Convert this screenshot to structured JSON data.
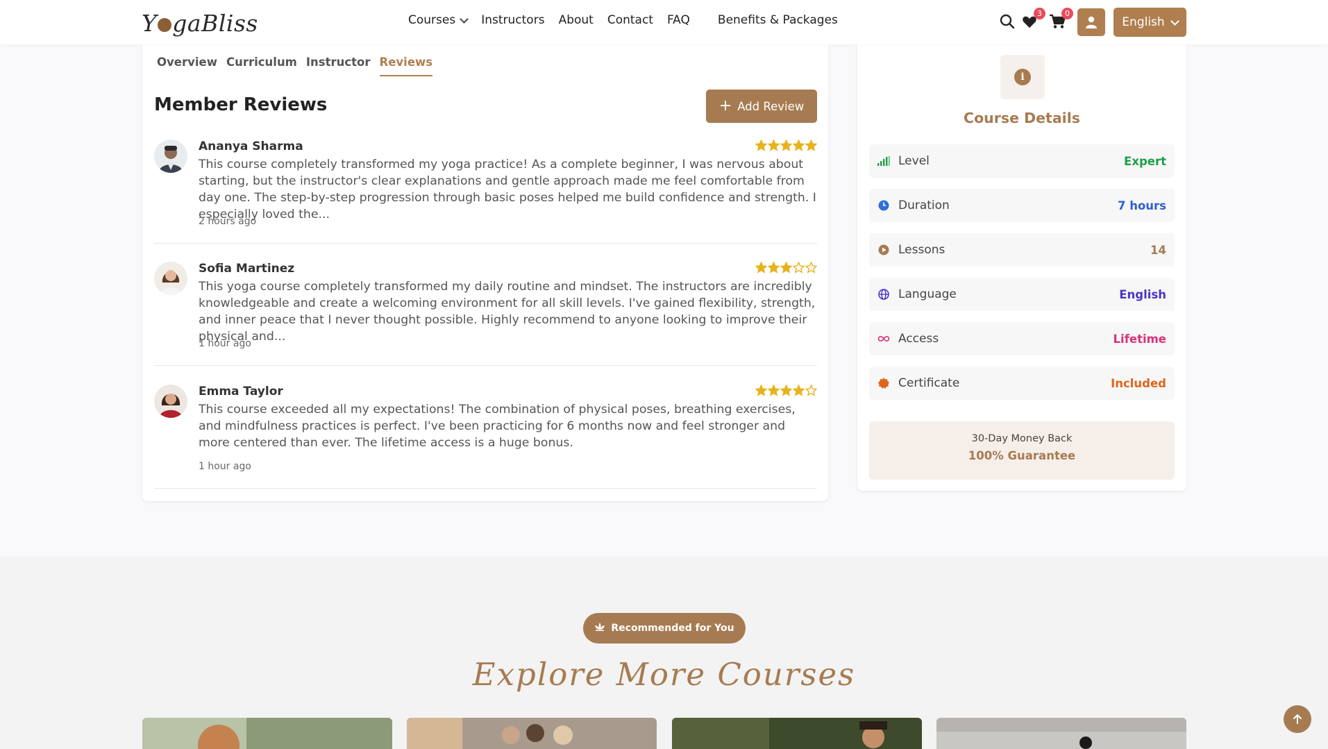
{
  "brand": {
    "name_prefix": "Y",
    "name_suffix": "gaBliss"
  },
  "nav": {
    "courses": "Courses",
    "instructors": "Instructors",
    "about": "About",
    "contact": "Contact",
    "faq": "FAQ",
    "benefits": "Benefits & Packages"
  },
  "header_actions": {
    "wishlist_count": "3",
    "cart_count": "0",
    "language": "English"
  },
  "tabs": [
    "Overview",
    "Curriculum",
    "Instructor",
    "Reviews"
  ],
  "active_tab": "Reviews",
  "reviews_section": {
    "title": "Member Reviews",
    "add_button": "Add Review",
    "reviews": [
      {
        "name": "Ananya Sharma",
        "rating": 5,
        "text": "This course completely transformed my yoga practice! As a complete beginner, I was nervous about starting, but the instructor's clear explanations and gentle approach made me feel comfortable from day one. The step-by-step progression through basic poses helped me build confidence and strength. I especially loved the...",
        "time": "2 hours ago"
      },
      {
        "name": "Sofia Martinez",
        "rating": 3,
        "text": "This yoga course completely transformed my daily routine and mindset. The instructors are incredibly knowledgeable and create a welcoming environment for all skill levels. I've gained flexibility, strength, and inner peace that I never thought possible. Highly recommend to anyone looking to improve their physical and...",
        "time": "1 hour ago"
      },
      {
        "name": "Emma Taylor",
        "rating": 4,
        "text": "This course exceeded all my expectations! The combination of physical poses, breathing exercises, and mindfulness practices is perfect. I've been practicing for 6 months now and feel stronger and more centered than ever. The lifetime access is a huge bonus.",
        "time": "1 hour ago"
      }
    ]
  },
  "course_details": {
    "title": "Course Details",
    "rows": [
      {
        "label": "Level",
        "value": "Expert",
        "color": "#1e9e4a",
        "icon": "signal-bars-icon"
      },
      {
        "label": "Duration",
        "value": "7 hours",
        "color": "#2f5fd0",
        "icon": "clock-icon"
      },
      {
        "label": "Lessons",
        "value": "14",
        "color": "#a77b51",
        "icon": "play-circle-icon"
      },
      {
        "label": "Language",
        "value": "English",
        "color": "#4a36c9",
        "icon": "globe-icon"
      },
      {
        "label": "Access",
        "value": "Lifetime",
        "color": "#d6337a",
        "icon": "infinity-icon"
      },
      {
        "label": "Certificate",
        "value": "Included",
        "color": "#e0651c",
        "icon": "certificate-icon"
      }
    ],
    "guarantee_line1": "30-Day Money Back",
    "guarantee_line2": "100% Guarantee"
  },
  "explore": {
    "pill": "Recommended for You",
    "title": "Explore More Courses"
  },
  "colors": {
    "accent": "#a77b51",
    "badge": "#e74c5b"
  }
}
